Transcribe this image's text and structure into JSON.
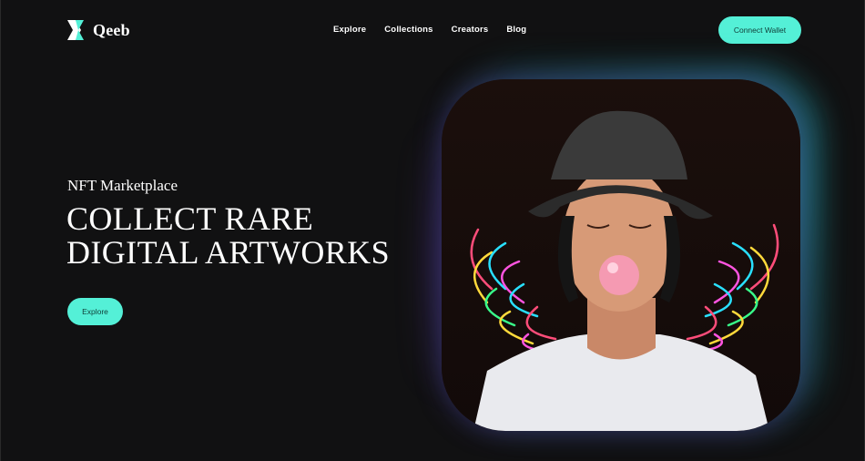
{
  "brand": {
    "name": "Qeeb",
    "logo_icon": "qeeb-logo-icon"
  },
  "nav": {
    "items": [
      {
        "label": "Explore"
      },
      {
        "label": "Collections"
      },
      {
        "label": "Creators"
      },
      {
        "label": "Blog"
      }
    ]
  },
  "header": {
    "cta_label": "Connect Wallet"
  },
  "hero": {
    "kicker": "NFT Marketplace",
    "headline_line1": "COLLECT RARE",
    "headline_line2": "DIGITAL ARTWORKS",
    "button_label": "Explore"
  },
  "colors": {
    "accent": "#54f0d7",
    "background": "#111112",
    "text": "#ffffff"
  },
  "artwork": {
    "icon": "nft-artwork-image"
  }
}
